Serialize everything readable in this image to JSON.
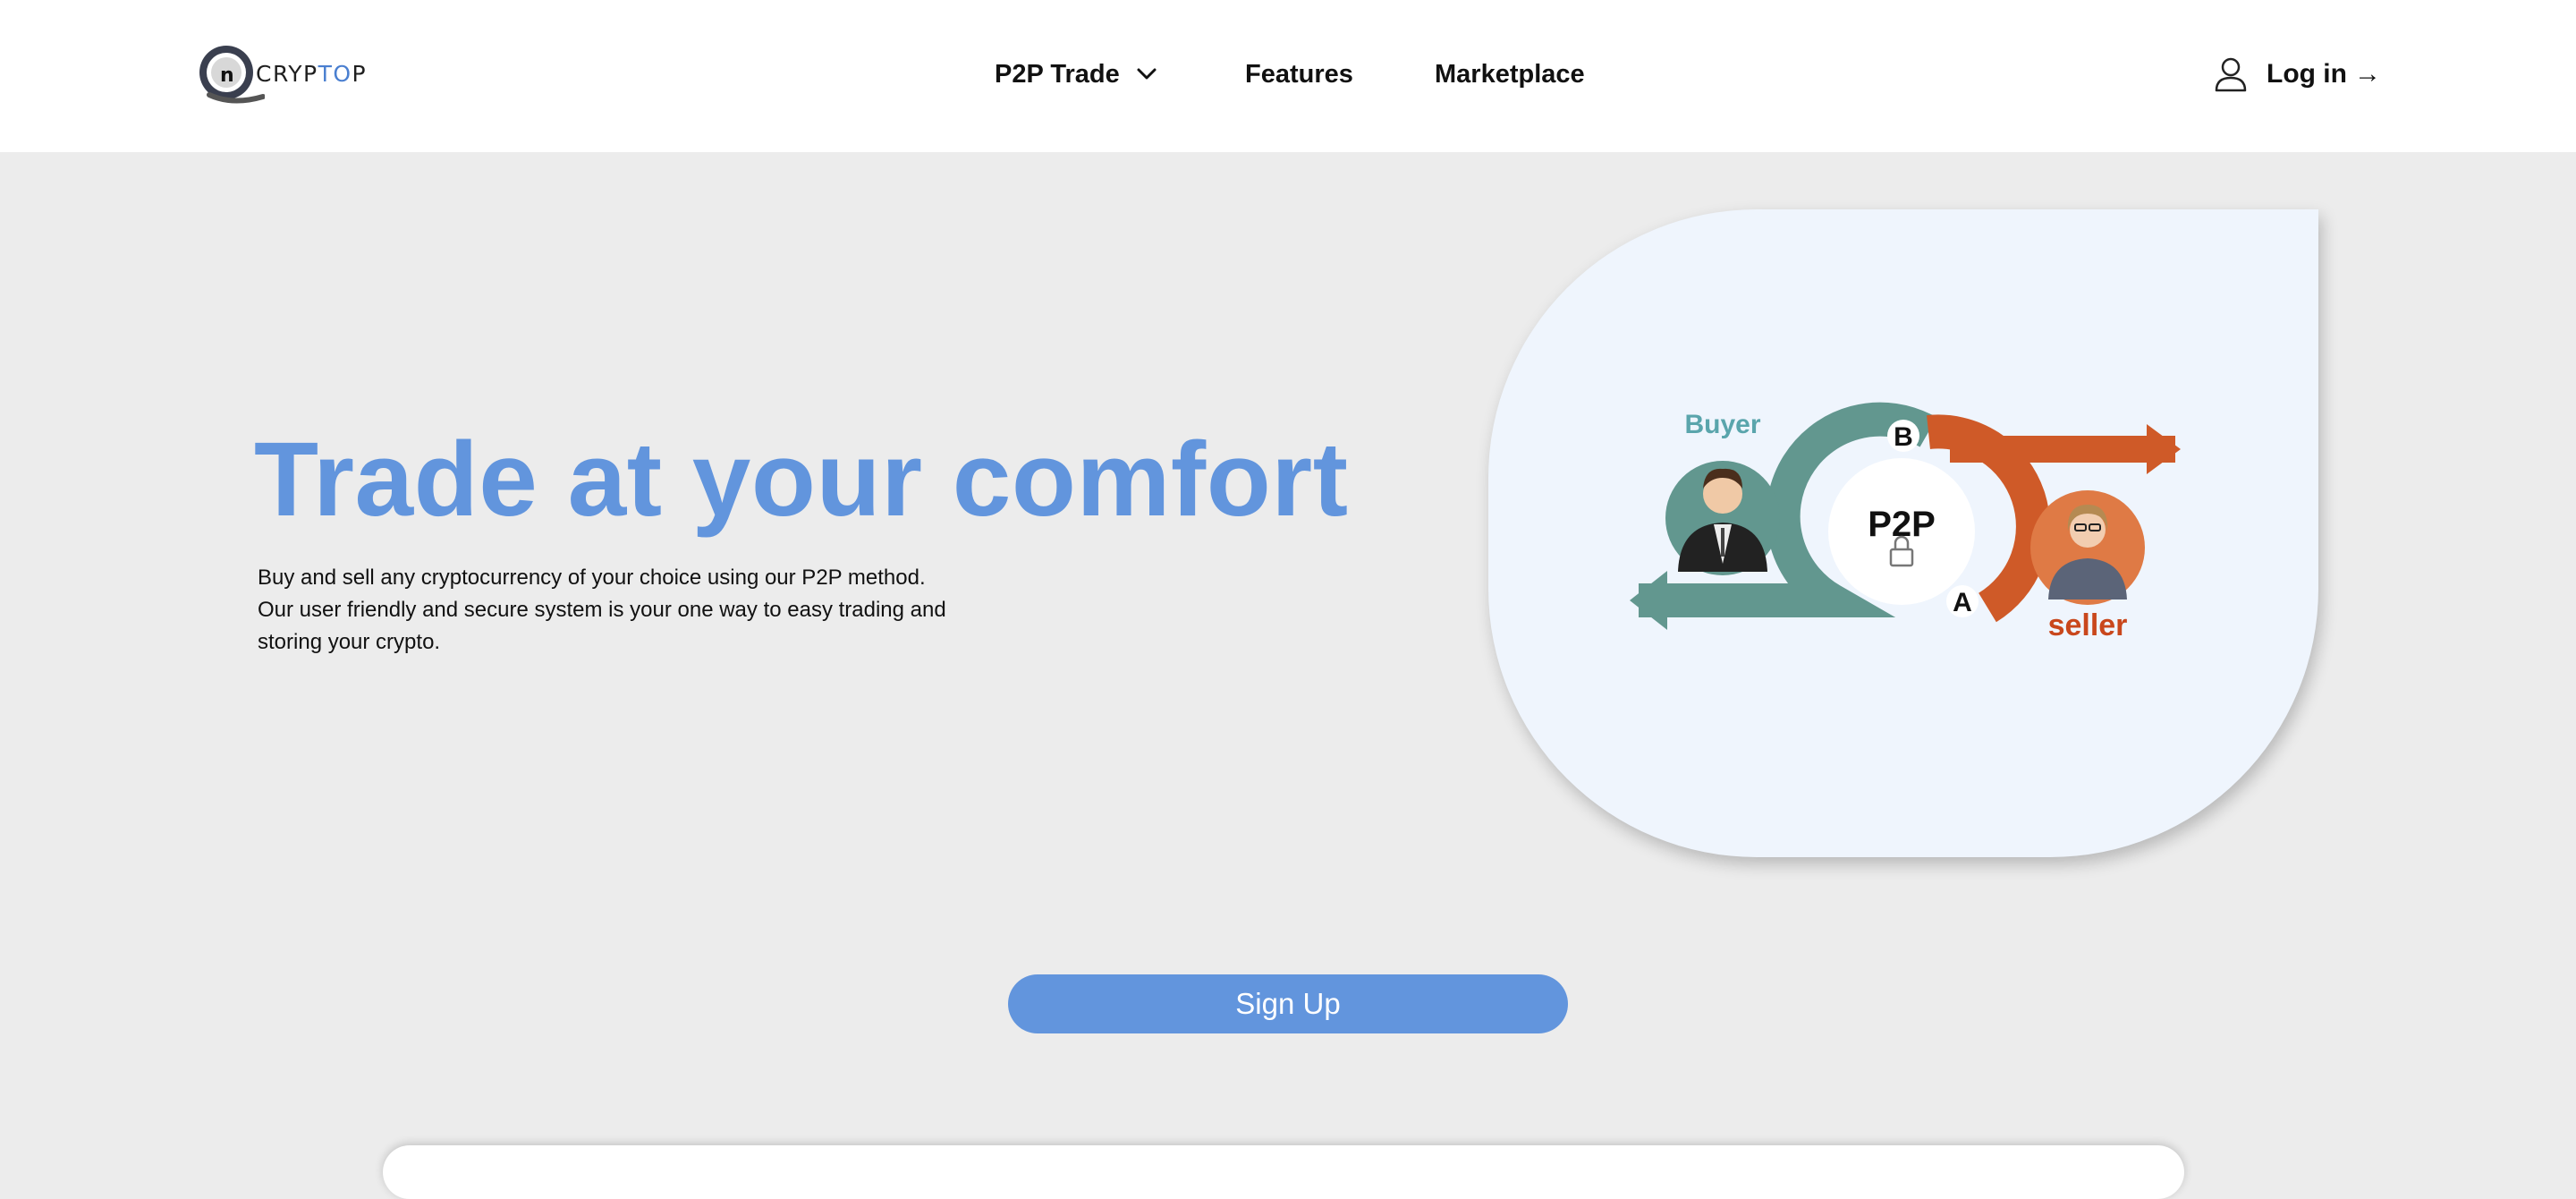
{
  "header": {
    "logo": {
      "prefix": "CRYP",
      "accent": "TO",
      "suffix": "P",
      "accent_color": "#4a7fd0"
    },
    "nav": [
      {
        "label": "P2P Trade",
        "has_dropdown": true
      },
      {
        "label": "Features"
      },
      {
        "label": "Marketplace"
      }
    ],
    "login": {
      "label": "Log in",
      "arrow": "→",
      "icon": "user-icon"
    }
  },
  "hero": {
    "title": "Trade at your comfort",
    "description": "Buy and sell any cryptocurrency of your choice using our P2P method. Our user friendly and secure system is your one way to easy trading and storing your crypto.",
    "illustration": {
      "buyer_label": "Buyer",
      "seller_label": "seller",
      "center_label": "P2P",
      "node_b": "B",
      "node_a": "A"
    },
    "signup_label": "Sign Up"
  },
  "colors": {
    "primary": "#6295dd",
    "background": "#ececec",
    "card": "#eff5fd",
    "teal": "#62978f",
    "orange": "#cf5a28"
  }
}
